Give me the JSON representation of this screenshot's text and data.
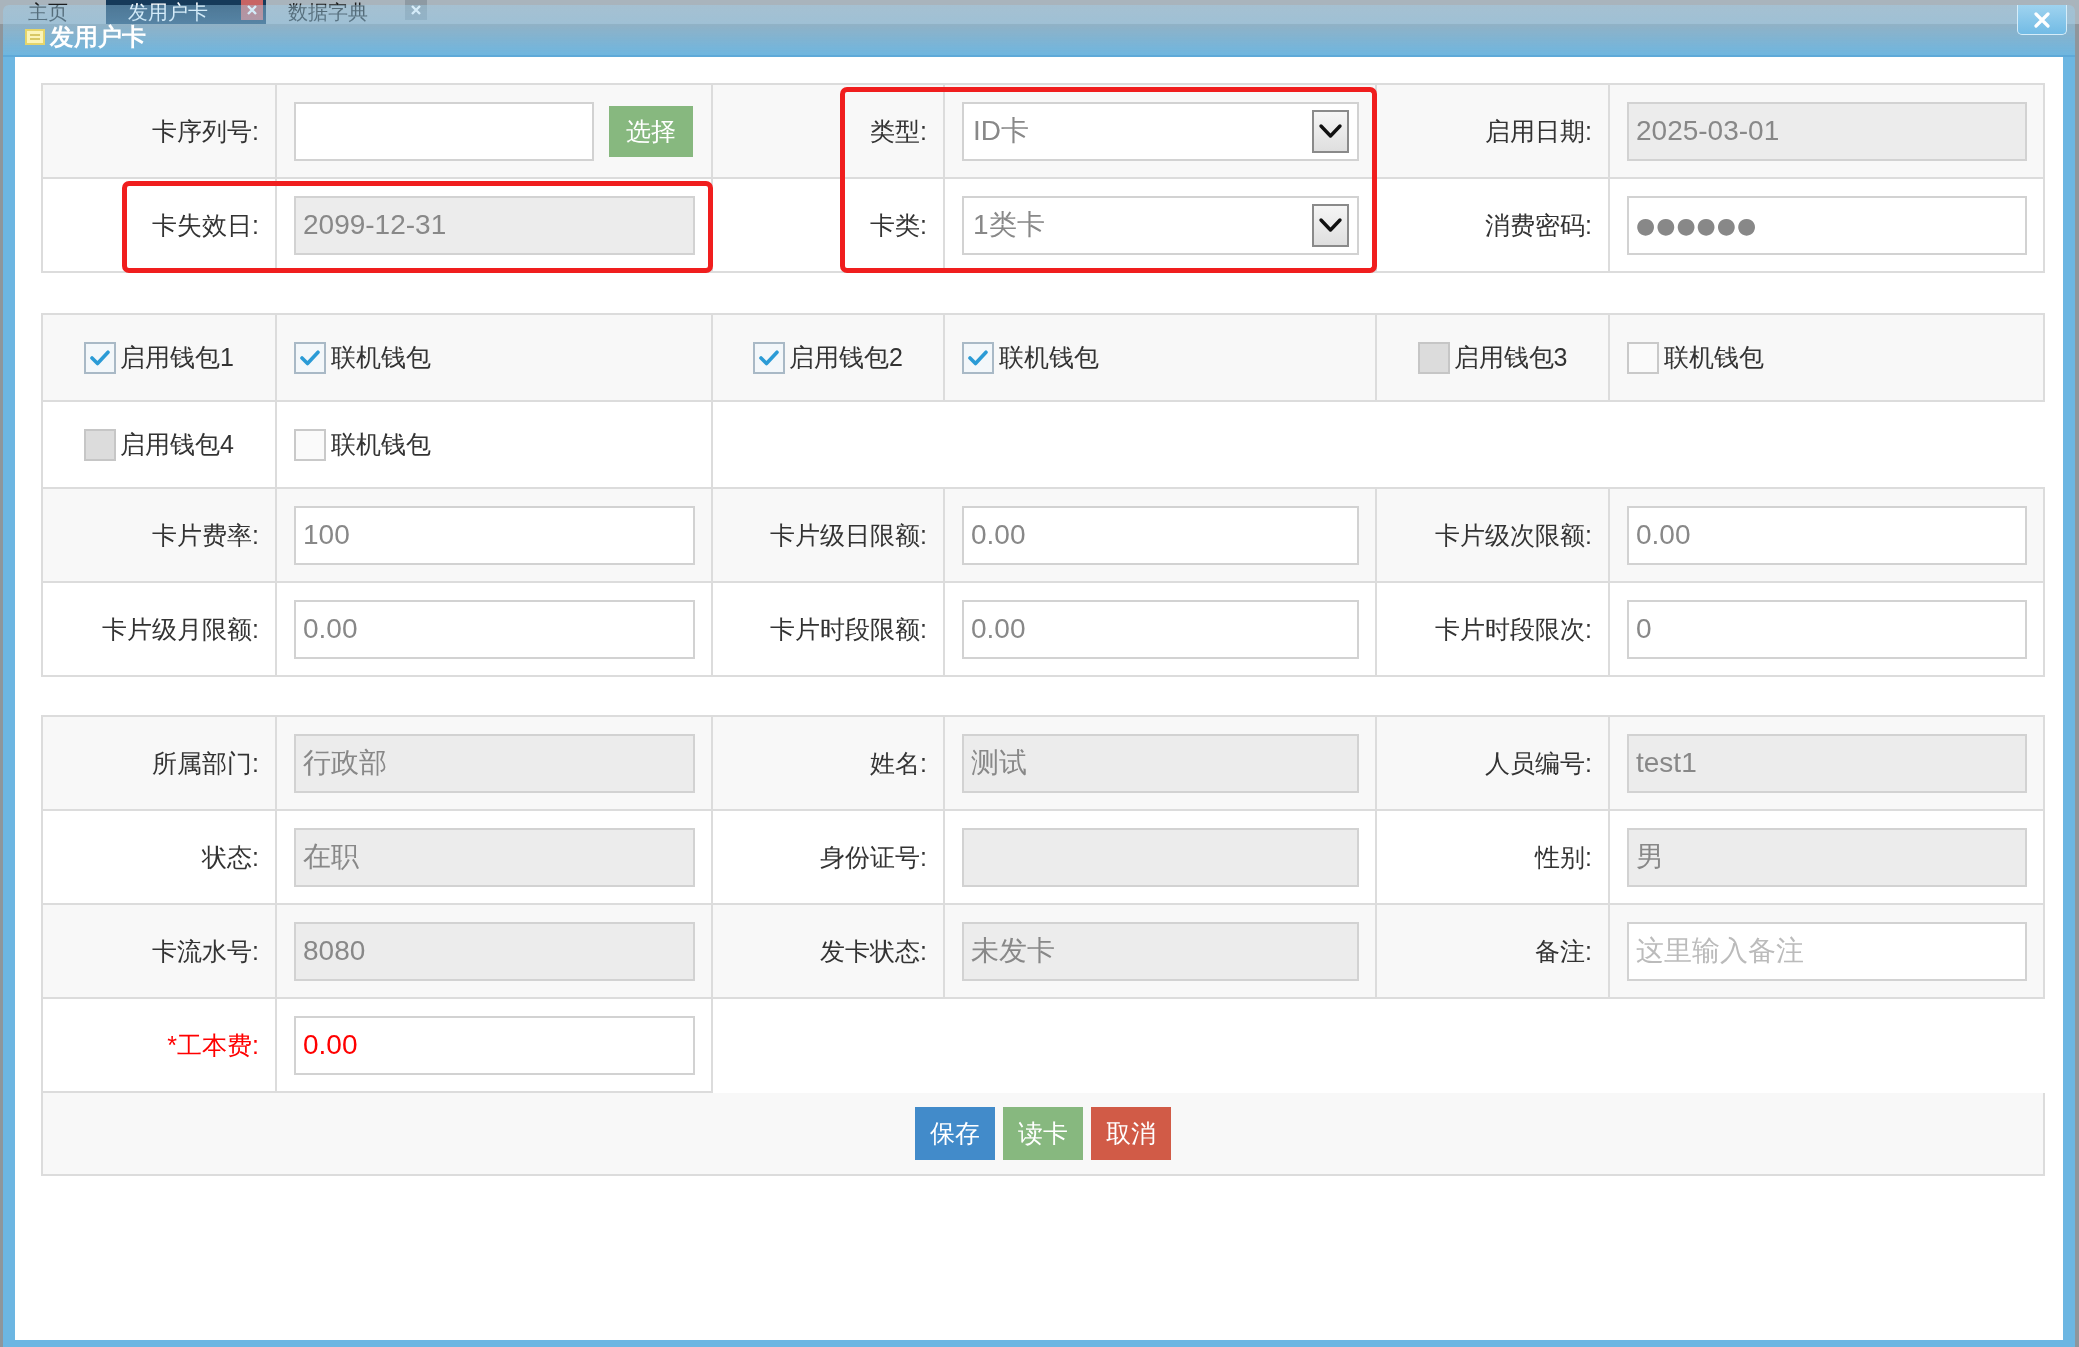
{
  "background_tabs": [
    {
      "label": "主页",
      "selected": false,
      "closable": false
    },
    {
      "label": "发用户卡",
      "selected": true,
      "closable": true
    },
    {
      "label": "数据字典",
      "selected": false,
      "closable": true
    }
  ],
  "dialog": {
    "title": "发用户卡"
  },
  "card_section": {
    "rows": [
      [
        {
          "label": "卡序列号:",
          "kind": "input-button",
          "button": "选择",
          "disabled": false,
          "highlighted": false
        },
        {
          "label": "类型:",
          "kind": "select",
          "value": "ID卡",
          "disabled": false,
          "highlighted": true
        },
        {
          "label": "启用日期:",
          "kind": "input",
          "value": "2025-03-01",
          "disabled": true,
          "highlighted": false
        }
      ],
      [
        {
          "label": "卡失效日:",
          "kind": "input",
          "value": "2099-12-31",
          "disabled": true,
          "highlighted": true
        },
        {
          "label": "卡类:",
          "kind": "select",
          "value": "1类卡",
          "disabled": false,
          "highlighted": true
        },
        {
          "label": "消费密码:",
          "kind": "password",
          "value": "●●●●●●",
          "disabled": false,
          "highlighted": false
        }
      ]
    ]
  },
  "wallet_section": {
    "wallets": [
      {
        "label": "启用钱包1",
        "checked": true,
        "disabled": false,
        "online": {
          "label": "联机钱包",
          "checked": true
        }
      },
      {
        "label": "启用钱包2",
        "checked": true,
        "disabled": false,
        "online": {
          "label": "联机钱包",
          "checked": true
        }
      },
      {
        "label": "启用钱包3",
        "checked": false,
        "disabled": true,
        "online": {
          "label": "联机钱包",
          "checked": false
        }
      },
      {
        "label": "启用钱包4",
        "checked": false,
        "disabled": true,
        "online": {
          "label": "联机钱包",
          "checked": false
        }
      }
    ],
    "rows": [
      [
        {
          "label": "卡片费率:",
          "kind": "input",
          "value": "100",
          "disabled": false
        },
        {
          "label": "卡片级日限额:",
          "kind": "input",
          "value": "0.00",
          "disabled": false
        },
        {
          "label": "卡片级次限额:",
          "kind": "input",
          "value": "0.00",
          "disabled": false
        }
      ],
      [
        {
          "label": "卡片级月限额:",
          "kind": "input",
          "value": "0.00",
          "disabled": false
        },
        {
          "label": "卡片时段限额:",
          "kind": "input",
          "value": "0.00",
          "disabled": false
        },
        {
          "label": "卡片时段限次:",
          "kind": "input",
          "value": "0",
          "disabled": false
        }
      ]
    ]
  },
  "person_section": {
    "rows": [
      [
        {
          "label": "所属部门:",
          "kind": "input",
          "value": "行政部",
          "disabled": true,
          "required": false
        },
        {
          "label": "姓名:",
          "kind": "input",
          "value": "测试",
          "disabled": true,
          "required": false
        },
        {
          "label": "人员编号:",
          "kind": "input",
          "value": "test1",
          "disabled": true,
          "required": false
        }
      ],
      [
        {
          "label": "状态:",
          "kind": "input",
          "value": "在职",
          "disabled": true,
          "required": false
        },
        {
          "label": "身份证号:",
          "kind": "input",
          "disabled": true,
          "required": false
        },
        {
          "label": "性别:",
          "kind": "input",
          "value": "男",
          "disabled": true,
          "required": false
        }
      ],
      [
        {
          "label": "卡流水号:",
          "kind": "input",
          "value": "8080",
          "disabled": true,
          "required": false
        },
        {
          "label": "发卡状态:",
          "kind": "input",
          "value": "未发卡",
          "disabled": true,
          "required": false
        },
        {
          "label": "备注:",
          "kind": "input",
          "placeholder": "这里输入备注",
          "disabled": false,
          "required": false
        }
      ],
      [
        {
          "label": "*工本费:",
          "kind": "input",
          "value": "0.00",
          "disabled": false,
          "required": true
        }
      ]
    ]
  },
  "buttons": [
    {
      "label": "保存",
      "kind": "save"
    },
    {
      "label": "读卡",
      "kind": "read-card"
    },
    {
      "label": "取消",
      "kind": "cancel"
    }
  ]
}
